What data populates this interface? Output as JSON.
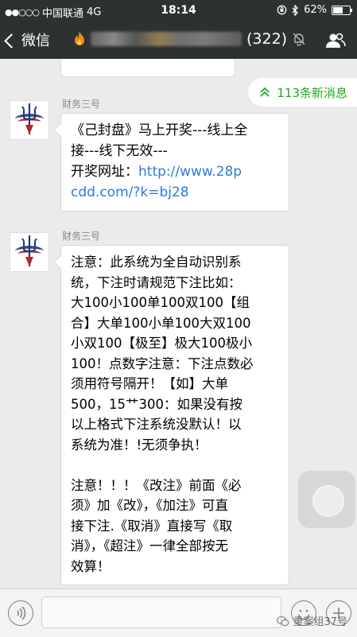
{
  "status_bar": {
    "signal": "●●○○○",
    "carrier": "中国联通",
    "network": "4G",
    "time": "18:14",
    "battery_percent": 62,
    "battery_text": "62%"
  },
  "nav": {
    "back_label": "微信",
    "member_count": "(322)"
  },
  "new_messages": {
    "label": "113条新消息"
  },
  "messages": [
    {
      "sender": "财务三号",
      "text": "《己封盘》马上开奖---线上全\n接---线下无效---\n开奖网址：",
      "link": "http://www.28p\ncdd.com/?k=bj28"
    },
    {
      "sender": "财务三号",
      "text": "注意：此系统为全自动识别系\n统，下注时请规范下注比如：\n大100小100单100双100【组\n合】大单100小单100大双100\n小双100【极至】极大100极小\n100！点数字注意：下注点数必\n须用符号隔开！【如】大单\n500，15艹300：如果没有按\n以上格式下注系统没默认！以\n系统为准！!无须争执！\n\n注意！！！《改注》前面《必\n须》加《改》，《加注》可直\n接下注.《取消》直接写《取\n消》，《超注》一律全部按无\n效算！"
    }
  ],
  "watermark": "重案组37号",
  "colors": {
    "nav_bg": "#2e3132",
    "chat_bg": "#ebebeb",
    "accent_green": "#1aad19",
    "link_blue": "#2c7bd6"
  }
}
